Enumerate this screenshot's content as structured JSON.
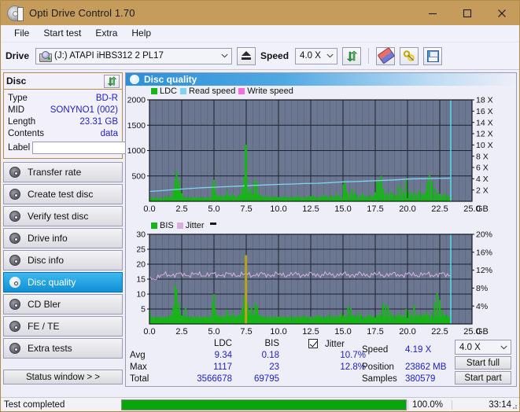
{
  "window": {
    "title": "Opti Drive Control 1.70",
    "icon": "disc-icon",
    "minimize": "minimize-icon",
    "maximize": "maximize-icon",
    "close": "close-icon"
  },
  "menu": {
    "items": [
      {
        "label": "File"
      },
      {
        "label": "Start test"
      },
      {
        "label": "Extra"
      },
      {
        "label": "Help"
      }
    ]
  },
  "toolbar": {
    "drive_label": "Drive",
    "drive_value": "(J:)   ATAPI iHBS312  2 PL17",
    "eject_icon": "eject-icon",
    "speed_label": "Speed",
    "speed_value": "4.0 X",
    "refresh_icon": "refresh-icon",
    "erase_icon": "eraser-icon",
    "tools_icon": "tools-icon",
    "save_icon": "save-icon"
  },
  "sidebar": {
    "disc_panel": {
      "title": "Disc",
      "refresh_icon": "refresh-icon",
      "rows": [
        {
          "key": "Type",
          "value": "BD-R"
        },
        {
          "key": "MID",
          "value": "SONYNO1 (002)"
        },
        {
          "key": "Length",
          "value": "23.31 GB"
        },
        {
          "key": "Contents",
          "value": "data"
        }
      ],
      "label_key": "Label",
      "label_value": "",
      "label_placeholder": "",
      "label_button_icon": "cd-icon"
    },
    "nav_items": [
      {
        "label": "Transfer rate",
        "active": false
      },
      {
        "label": "Create test disc",
        "active": false
      },
      {
        "label": "Verify test disc",
        "active": false
      },
      {
        "label": "Drive info",
        "active": false
      },
      {
        "label": "Disc info",
        "active": false
      },
      {
        "label": "Disc quality",
        "active": true
      },
      {
        "label": "CD Bler",
        "active": false
      },
      {
        "label": "FE / TE",
        "active": false
      },
      {
        "label": "Extra tests",
        "active": false
      }
    ],
    "status_button": "Status window > >"
  },
  "panel": {
    "title": "Disc quality",
    "icon": "disc-quality-icon"
  },
  "stats": {
    "col_ldc": "LDC",
    "col_bis": "BIS",
    "row_avg": "Avg",
    "row_max": "Max",
    "row_total": "Total",
    "ldc_avg": "9.34",
    "ldc_max": "1117",
    "ldc_total": "3566678",
    "bis_avg": "0.18",
    "bis_max": "23",
    "bis_total": "69795",
    "jitter_label": "Jitter",
    "jitter_checked": true,
    "jitter_avg": "10.7%",
    "jitter_max": "12.8%",
    "speed_label": "Speed",
    "speed_value": "4.19 X",
    "position_label": "Position",
    "position_value": "23862 MB",
    "samples_label": "Samples",
    "samples_value": "380579",
    "speed_select": "4.0 X",
    "start_full": "Start full",
    "start_part": "Start part"
  },
  "statusbar": {
    "message": "Test completed",
    "progress_percent": "100.0%",
    "progress_value": 100,
    "elapsed": "33:14"
  },
  "colors": {
    "titlebar": "#c69c5d",
    "accent": "#2c8fd8",
    "ldc": "#17b517",
    "bis": "#17b517",
    "read_speed": "#7fd4f2",
    "write_speed": "#f56ddc",
    "jitter": "#d9aede",
    "plot_bg": "#6b7790",
    "progress": "#0aa50a",
    "value_text": "#2020c8"
  },
  "chart_data": [
    {
      "type": "line",
      "name": "ldc-chart",
      "title": "",
      "xlabel": "GB",
      "ylabel": "",
      "xlim": [
        0,
        25
      ],
      "ylim": [
        0,
        2000
      ],
      "y2lim": [
        0,
        18
      ],
      "xticks": [
        "0.0",
        "2.5",
        "5.0",
        "7.5",
        "10.0",
        "12.5",
        "15.0",
        "17.5",
        "20.0",
        "22.5",
        "25.0"
      ],
      "yticks": [
        "500",
        "1000",
        "1500",
        "2000"
      ],
      "y2ticks": [
        "2 X",
        "4 X",
        "6 X",
        "8 X",
        "10 X",
        "12 X",
        "14 X",
        "16 X",
        "18 X"
      ],
      "x_unit": "GB",
      "grid": true,
      "legend": [
        {
          "label": "LDC",
          "color": "#17b517"
        },
        {
          "label": "Read speed",
          "color": "#7fd4f2"
        },
        {
          "label": "Write speed",
          "color": "#f56ddc"
        }
      ],
      "series": [
        {
          "name": "LDC",
          "color": "#17b517",
          "kind": "bars",
          "x": [
            0.05,
            0.2,
            0.35,
            0.5,
            0.65,
            0.8,
            0.95,
            1.1,
            1.25,
            1.4,
            1.55,
            1.7,
            1.85,
            2.0,
            2.1,
            2.2,
            2.3,
            2.4,
            2.5,
            2.65,
            2.8,
            2.95,
            3.1,
            3.25,
            3.4,
            3.55,
            3.7,
            3.85,
            4.0,
            4.15,
            4.3,
            4.45,
            4.6,
            4.75,
            4.9,
            5.0,
            5.1,
            5.25,
            5.4,
            5.55,
            5.7,
            5.85,
            6.0,
            6.15,
            6.3,
            6.45,
            6.6,
            6.75,
            6.9,
            7.05,
            7.2,
            7.35,
            7.45,
            7.5,
            7.55,
            7.7,
            7.85,
            8.0,
            8.15,
            8.3,
            8.45,
            8.6,
            8.75,
            8.9,
            9.05,
            9.2,
            9.35,
            9.5,
            9.65,
            9.8,
            9.95,
            10.1,
            10.3,
            10.5,
            10.7,
            10.9,
            11.1,
            11.3,
            11.5,
            11.7,
            11.9,
            12.1,
            12.3,
            12.5,
            12.7,
            12.9,
            13.1,
            13.3,
            13.5,
            13.7,
            13.9,
            14.1,
            14.3,
            14.5,
            14.7,
            14.9,
            15.05,
            15.15,
            15.3,
            15.5,
            15.7,
            15.9,
            16.1,
            16.3,
            16.5,
            16.7,
            16.9,
            17.1,
            17.3,
            17.5,
            17.65,
            17.8,
            17.95,
            18.1,
            18.3,
            18.5,
            18.7,
            18.9,
            19.1,
            19.3,
            19.5,
            19.7,
            19.9,
            20.1,
            20.3,
            20.5,
            20.7,
            20.9,
            21.1,
            21.3,
            21.45,
            21.55,
            21.7,
            21.9,
            22.1,
            22.3,
            22.5,
            22.7,
            22.9,
            23.1,
            23.3
          ],
          "values": [
            60,
            40,
            35,
            30,
            45,
            35,
            30,
            40,
            35,
            120,
            60,
            80,
            250,
            450,
            600,
            300,
            420,
            200,
            160,
            90,
            60,
            70,
            50,
            60,
            55,
            70,
            60,
            50,
            65,
            60,
            55,
            70,
            60,
            50,
            330,
            420,
            200,
            120,
            90,
            110,
            80,
            100,
            210,
            120,
            90,
            150,
            100,
            80,
            120,
            140,
            260,
            480,
            1117,
            900,
            400,
            180,
            250,
            140,
            420,
            380,
            160,
            120,
            90,
            70,
            110,
            90,
            60,
            80,
            70,
            90,
            60,
            80,
            70,
            100,
            80,
            60,
            90,
            70,
            110,
            80,
            60,
            90,
            70,
            100,
            120,
            80,
            60,
            90,
            140,
            100,
            70,
            120,
            90,
            160,
            110,
            80,
            330,
            400,
            200,
            150,
            250,
            180,
            120,
            90,
            160,
            110,
            90,
            130,
            100,
            180,
            420,
            380,
            500,
            260,
            180,
            140,
            200,
            160,
            120,
            330,
            260,
            180,
            420,
            200,
            150,
            190,
            140,
            220,
            170,
            130,
            200,
            380,
            520,
            400,
            260,
            180,
            150,
            120,
            160,
            120,
            90
          ]
        },
        {
          "name": "Read speed",
          "color": "#7fd4f2",
          "kind": "line",
          "x": [
            0.0,
            1.0,
            2.0,
            3.0,
            4.0,
            5.0,
            6.0,
            7.0,
            8.0,
            9.0,
            10.0,
            11.0,
            12.0,
            13.0,
            14.0,
            15.0,
            16.0,
            17.0,
            18.0,
            19.0,
            20.0,
            21.0,
            22.0,
            23.3
          ],
          "values": [
            1.75,
            1.9,
            2.1,
            2.25,
            2.4,
            2.5,
            2.6,
            2.7,
            2.8,
            2.9,
            3.0,
            3.05,
            3.15,
            3.2,
            3.3,
            3.45,
            3.5,
            3.6,
            3.7,
            3.8,
            3.95,
            4.0,
            4.05,
            4.1
          ]
        }
      ],
      "marker_line": {
        "x": 23.35,
        "color": "#4fe3f5"
      }
    },
    {
      "type": "line",
      "name": "bis-chart",
      "title": "",
      "xlabel": "GB",
      "ylabel": "",
      "xlim": [
        0,
        25
      ],
      "ylim": [
        0,
        30
      ],
      "y2lim": [
        0,
        20
      ],
      "xticks": [
        "0.0",
        "2.5",
        "5.0",
        "7.5",
        "10.0",
        "12.5",
        "15.0",
        "17.5",
        "20.0",
        "22.5",
        "25.0"
      ],
      "yticks": [
        "5",
        "10",
        "15",
        "20",
        "25",
        "30"
      ],
      "y2ticks": [
        "4%",
        "8%",
        "12%",
        "16%",
        "20%"
      ],
      "x_unit": "GB",
      "grid": true,
      "legend": [
        {
          "label": "BIS",
          "color": "#17b517"
        },
        {
          "label": "Jitter",
          "color": "#d9aede"
        }
      ],
      "series": [
        {
          "name": "BIS",
          "color": "#17b517",
          "kind": "bars",
          "x": [
            0.05,
            0.2,
            0.35,
            0.5,
            0.65,
            0.8,
            0.95,
            1.1,
            1.25,
            1.4,
            1.55,
            1.7,
            1.85,
            2.0,
            2.1,
            2.2,
            2.3,
            2.4,
            2.5,
            2.65,
            2.8,
            2.95,
            3.1,
            3.25,
            3.4,
            3.55,
            3.7,
            3.85,
            4.0,
            4.15,
            4.3,
            4.45,
            4.6,
            4.75,
            4.9,
            5.0,
            5.1,
            5.25,
            5.4,
            5.55,
            5.7,
            5.85,
            6.0,
            6.15,
            6.3,
            6.45,
            6.6,
            6.75,
            6.9,
            7.05,
            7.2,
            7.35,
            7.45,
            7.5,
            7.6,
            7.75,
            7.9,
            8.05,
            8.2,
            8.35,
            8.5,
            8.65,
            8.8,
            8.95,
            9.1,
            9.3,
            9.5,
            9.7,
            9.9,
            10.1,
            10.3,
            10.5,
            10.7,
            10.9,
            11.1,
            11.3,
            11.5,
            11.7,
            11.9,
            12.1,
            12.3,
            12.5,
            12.7,
            12.9,
            13.1,
            13.3,
            13.5,
            13.7,
            13.9,
            14.1,
            14.3,
            14.5,
            14.7,
            14.9,
            15.05,
            15.2,
            15.4,
            15.6,
            15.8,
            16.0,
            16.2,
            16.4,
            16.6,
            16.8,
            17.0,
            17.2,
            17.4,
            17.6,
            17.75,
            17.9,
            18.1,
            18.3,
            18.5,
            18.7,
            18.9,
            19.1,
            19.3,
            19.5,
            19.7,
            19.9,
            20.1,
            20.3,
            20.5,
            20.7,
            20.9,
            21.1,
            21.3,
            21.45,
            21.55,
            21.7,
            21.9,
            22.1,
            22.3,
            22.5,
            22.7,
            22.9,
            23.1,
            23.3
          ],
          "values": [
            4.2,
            2.0,
            1.8,
            1.5,
            2.2,
            1.7,
            1.6,
            2.0,
            1.8,
            2.6,
            2.0,
            3.4,
            6.0,
            13.0,
            11.5,
            5.0,
            7.0,
            3.5,
            2.8,
            2.0,
            5.2,
            2.4,
            2.0,
            2.2,
            1.8,
            2.6,
            2.0,
            1.8,
            2.4,
            2.0,
            1.9,
            2.6,
            2.1,
            1.8,
            7.2,
            10.0,
            5.0,
            3.0,
            2.4,
            2.8,
            2.2,
            2.6,
            4.8,
            3.0,
            2.4,
            3.6,
            2.6,
            2.2,
            3.0,
            3.4,
            5.5,
            9.0,
            23.0,
            18.0,
            7.0,
            4.0,
            5.6,
            3.4,
            7.0,
            6.0,
            3.2,
            2.6,
            2.2,
            2.0,
            2.6,
            2.2,
            1.9,
            2.2,
            2.0,
            2.4,
            1.9,
            2.2,
            2.0,
            2.6,
            2.2,
            1.8,
            2.4,
            2.0,
            2.8,
            2.2,
            1.8,
            2.4,
            2.0,
            2.6,
            3.0,
            2.2,
            1.8,
            2.4,
            3.4,
            2.6,
            2.0,
            3.0,
            2.4,
            3.8,
            2.8,
            2.2,
            6.0,
            5.2,
            3.0,
            2.6,
            4.0,
            3.2,
            2.4,
            2.0,
            3.4,
            2.6,
            2.2,
            3.0,
            2.6,
            3.8,
            7.0,
            6.2,
            5.8,
            4.0,
            3.0,
            2.6,
            3.6,
            3.0,
            2.4,
            5.0,
            4.2,
            3.2,
            6.4,
            3.4,
            2.8,
            3.4,
            2.8,
            4.0,
            3.2,
            2.6,
            3.8,
            7.0,
            10.2,
            8.0,
            4.6,
            3.2,
            2.8,
            2.4,
            3.0,
            2.4,
            2.0
          ]
        },
        {
          "name": "Jitter",
          "color": "#d9aede",
          "kind": "noisy-line",
          "baseline": 16.5,
          "noise": 1.2,
          "start_value": 15.0
        }
      ],
      "marker_line": {
        "x": 23.35,
        "color": "#4fe3f5"
      }
    }
  ]
}
